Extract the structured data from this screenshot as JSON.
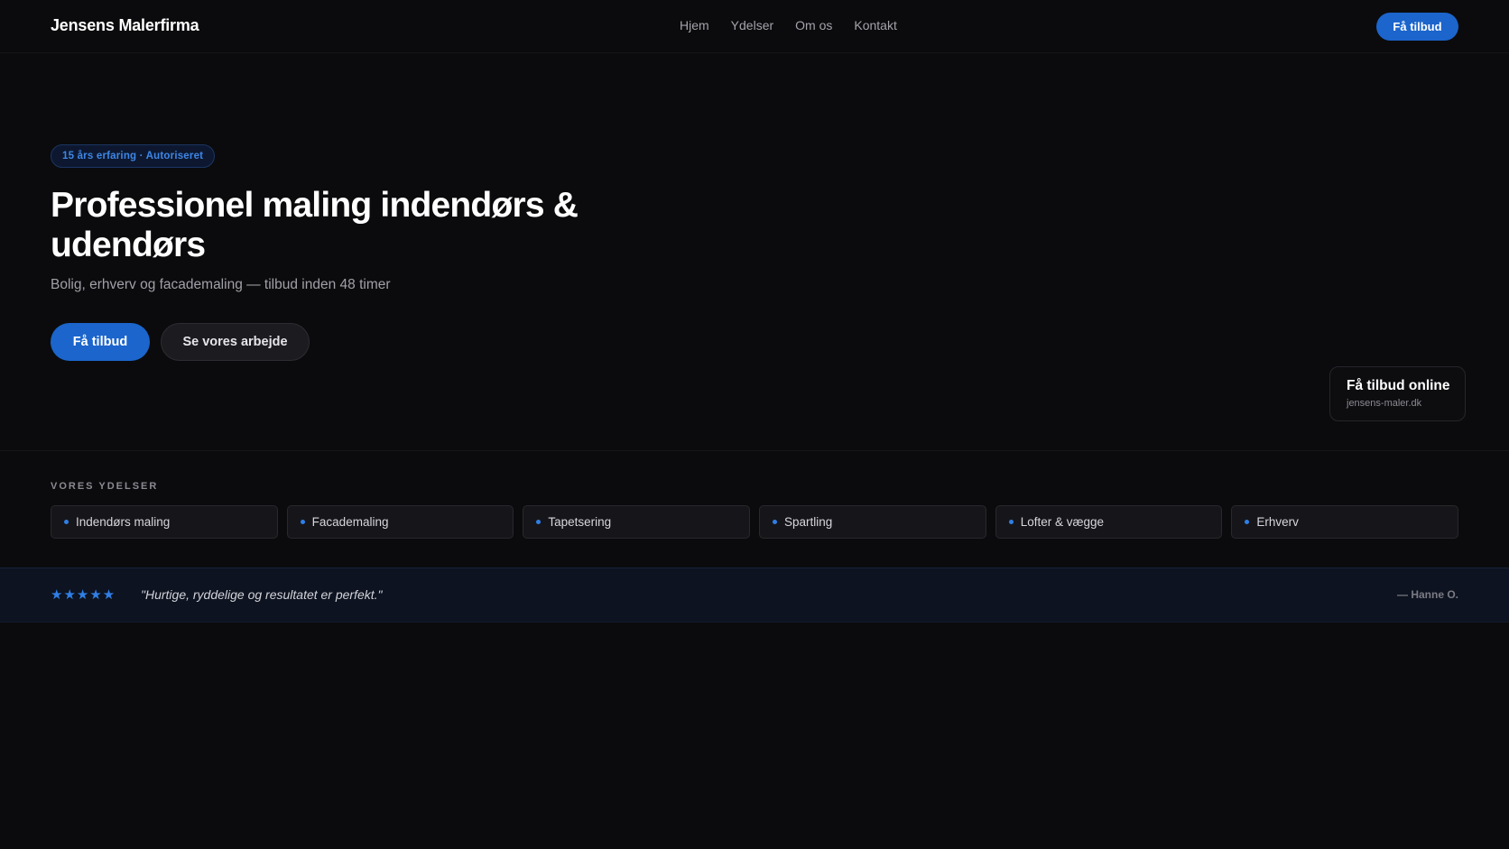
{
  "header": {
    "brand": "Jensens Malerfirma",
    "nav": [
      "Hjem",
      "Ydelser",
      "Om os",
      "Kontakt"
    ],
    "cta_label": "Få tilbud"
  },
  "hero": {
    "badge": "15 års erfaring · Autoriseret",
    "title": "Professionel maling indendørs & udendørs",
    "subtitle": "Bolig, erhverv og facademaling — tilbud inden 48 timer",
    "primary_label": "Få tilbud",
    "secondary_label": "Se vores arbejde",
    "online_card": {
      "title": "Få tilbud online",
      "url": "jensens-maler.dk"
    }
  },
  "services": {
    "label": "VORES YDELSER",
    "items": [
      "Indendørs maling",
      "Facademaling",
      "Tapetsering",
      "Spartling",
      "Lofter & vægge",
      "Erhverv"
    ]
  },
  "testimonial": {
    "rating": 5,
    "stars": "★★★★★",
    "quote": "\"Hurtige, ryddelige og resultatet er perfekt.\"",
    "author": "— Hanne O."
  },
  "colors": {
    "background": "#0b0b0d",
    "accent": "#1b65cc",
    "badge_text": "#3d86e6",
    "testimonial_bg": "#0d1320"
  }
}
